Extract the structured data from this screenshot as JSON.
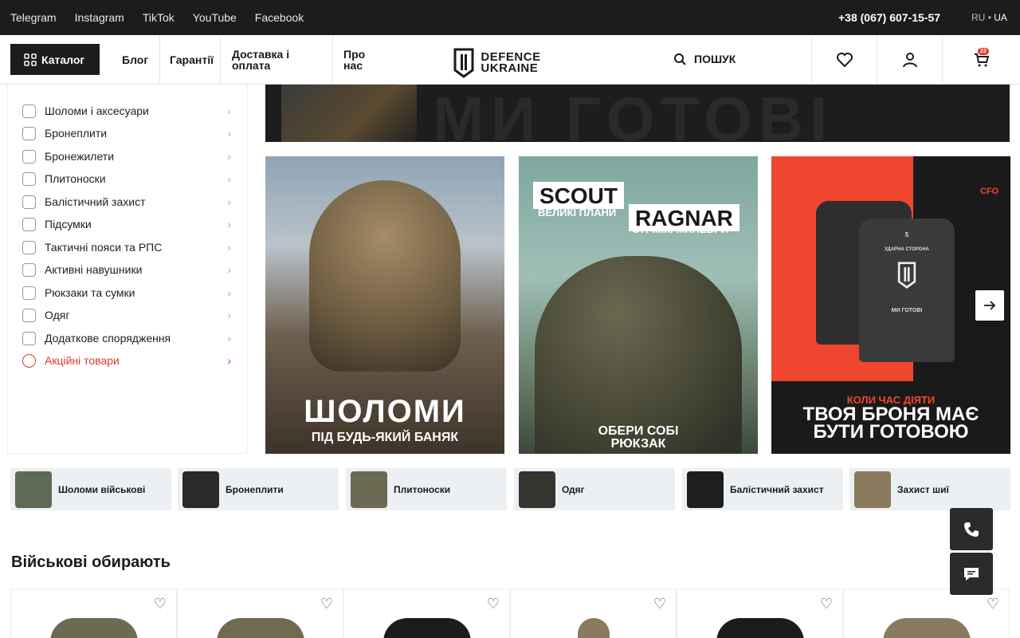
{
  "topbar": {
    "social": [
      "Telegram",
      "Instagram",
      "TikTok",
      "YouTube",
      "Facebook"
    ],
    "phone": "+38 (067) 607-15-57",
    "lang_ru": "RU",
    "lang_sep": "•",
    "lang_ua": "UA"
  },
  "header": {
    "catalog_label": "Каталог",
    "nav": [
      "Блог",
      "Гарантії",
      "Доставка і оплата",
      "Про нас"
    ],
    "logo_line1": "DEFENCE",
    "logo_line2": "UKRAINE",
    "search_label": "ПОШУК",
    "cart_count": "23"
  },
  "sidebar": {
    "items": [
      {
        "label": "Шоломи і аксесуари",
        "icon": "helmet-icon"
      },
      {
        "label": "Бронеплити",
        "icon": "armor-plate-icon"
      },
      {
        "label": "Бронежилети",
        "icon": "vest-icon"
      },
      {
        "label": "Плитоноски",
        "icon": "plate-carrier-icon"
      },
      {
        "label": "Балістичний захист",
        "icon": "ballistic-icon"
      },
      {
        "label": "Підсумки",
        "icon": "pouch-icon"
      },
      {
        "label": "Тактичні пояси та РПС",
        "icon": "belt-icon"
      },
      {
        "label": "Активні навушники",
        "icon": "headphones-icon"
      },
      {
        "label": "Рюкзаки та сумки",
        "icon": "backpack-icon"
      },
      {
        "label": "Одяг",
        "icon": "shirt-icon"
      },
      {
        "label": "Додаткове спорядження",
        "icon": "gear-icon"
      },
      {
        "label": "Акційні товари",
        "icon": "percent-icon"
      }
    ]
  },
  "top_banner": {
    "text": "МИ ГОТОВІ"
  },
  "banners": {
    "b1_title": "ШОЛОМИ",
    "b1_sub": "ПІД БУДЬ-ЯКИЙ БАНЯК",
    "b2_scout": "SCOUT",
    "b2_scout_sub": "ВЕЛИКІ ПЛАНИ",
    "b2_ragnar": "RAGNAR",
    "b2_ragnar_sub": "СТРІМКІ МАНЕВРИ",
    "b2_cta_1": "ОБЕРИ СОБІ",
    "b2_cta_2": "РЮКЗАК",
    "b3_cfo": "CFO",
    "b3_plate_1": "5",
    "b3_plate_2": "УДАРНА СТОРОНА",
    "b3_plate_3": "МИ ГОТОВІ",
    "b3_small": "КОЛИ ЧАС ДІЯТИ",
    "b3_title_1": "ТВОЯ БРОНЯ МАЄ",
    "b3_title_2": "БУТИ ГОТОВОЮ"
  },
  "categories": [
    {
      "label": "Шоломи військові",
      "color": "#5f6a55"
    },
    {
      "label": "Бронеплити",
      "color": "#2a2a2a"
    },
    {
      "label": "Плитоноски",
      "color": "#6b6a52"
    },
    {
      "label": "Одяг",
      "color": "#33352e"
    },
    {
      "label": "Балістичний захист",
      "color": "#1e1e1e"
    },
    {
      "label": "Захист шиї",
      "color": "#8a7a5e"
    }
  ],
  "section": {
    "title": "Військові обирають"
  },
  "products": [
    {
      "color": "#6b6a52"
    },
    {
      "color": "#6f6a50"
    },
    {
      "color": "#1c1c1c"
    },
    {
      "color": "#8a7a5e"
    },
    {
      "color": "#1c1c1c"
    },
    {
      "color": "#8a7a5e"
    }
  ],
  "colors": {
    "accent": "#e0392b",
    "dark": "#1c1c1c"
  }
}
